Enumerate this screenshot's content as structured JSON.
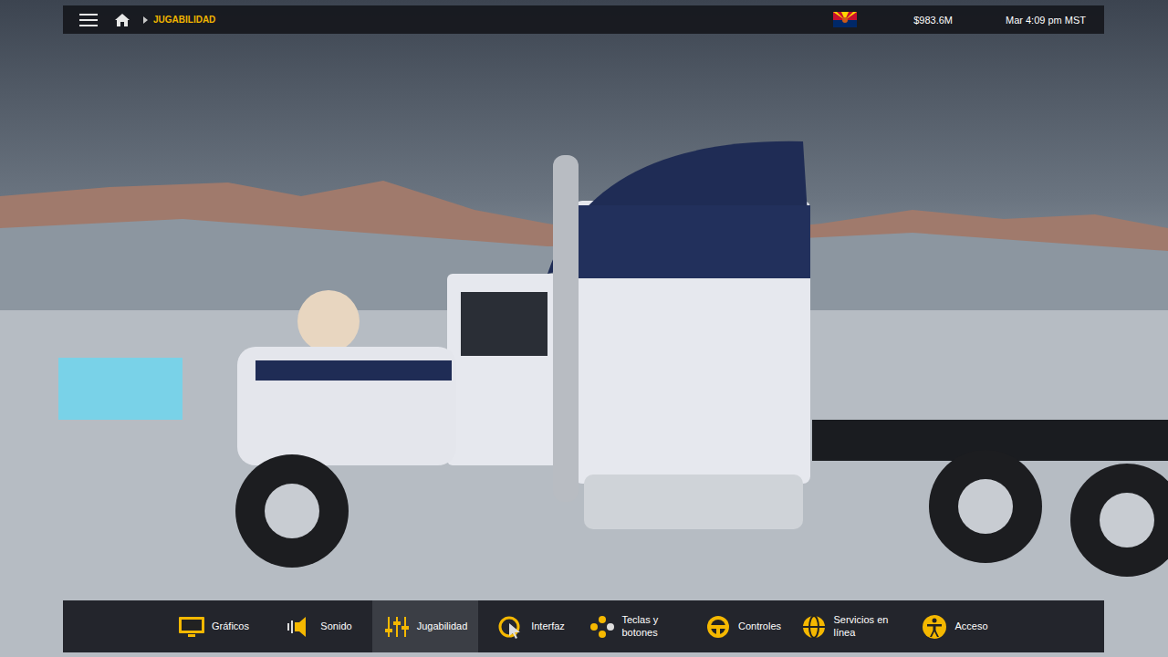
{
  "top_bar": {
    "breadcrumb": "JUGABILIDAD",
    "money": "$983.6M",
    "clock": "Mar 4:09 pm MST"
  },
  "tabs": [
    {
      "label": "Gráficos",
      "selected": false
    },
    {
      "label": "Sonido",
      "selected": false
    },
    {
      "label": "Jugabilidad",
      "selected": true
    },
    {
      "label": "Interfaz",
      "selected": false
    },
    {
      "label": "Teclas y botones",
      "selected": false
    },
    {
      "label": "Controles",
      "selected": false
    },
    {
      "label": "Servicios en línea",
      "selected": false
    },
    {
      "label": "Acceso",
      "selected": false
    }
  ]
}
